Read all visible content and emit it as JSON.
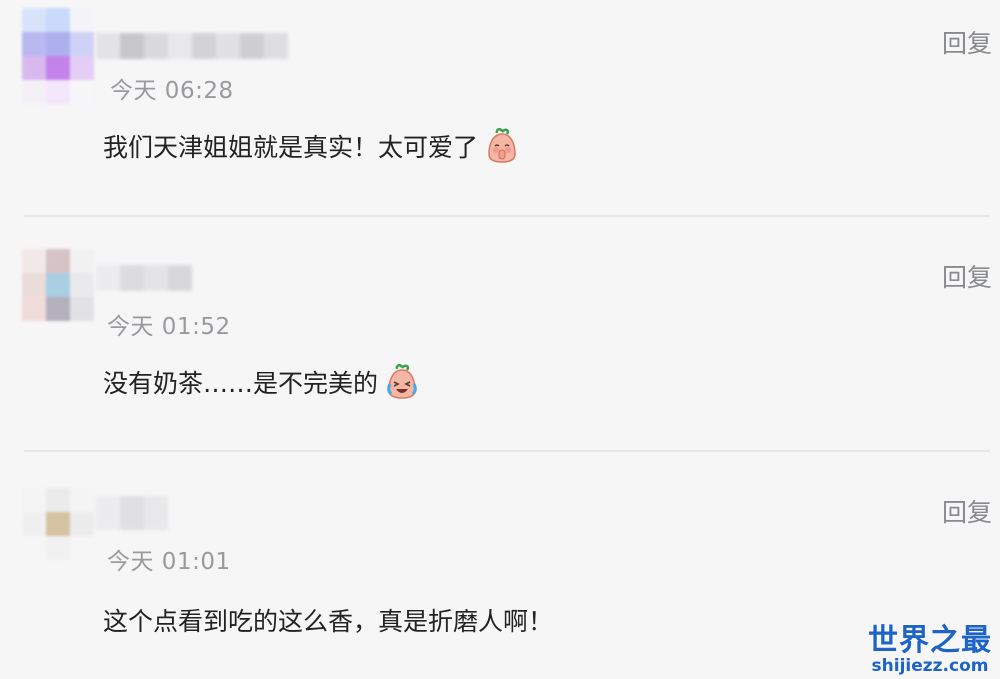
{
  "comments": [
    {
      "time": "今天 06:28",
      "reply_label": "回复",
      "text": "我们天津姐姐就是真实！太可爱了",
      "emoji": "shy-radish-emoji"
    },
    {
      "time": "今天 01:52",
      "reply_label": "回复",
      "text": "没有奶茶……是不完美的",
      "emoji": "crying-laughing-radish-emoji"
    },
    {
      "time": "今天 01:01",
      "reply_label": "回复",
      "text": "这个点看到吃的这么香，真是折磨人啊！",
      "emoji": ""
    }
  ],
  "watermark": {
    "title": "世界之最",
    "url": "shijiezz.com"
  },
  "colors": {
    "background": "#f6f6f7",
    "time_text": "#9a9a9e",
    "reply_text": "#888a8e",
    "content_text": "#222222",
    "divider": "#e6e6e8",
    "watermark": "#1e63c6"
  }
}
